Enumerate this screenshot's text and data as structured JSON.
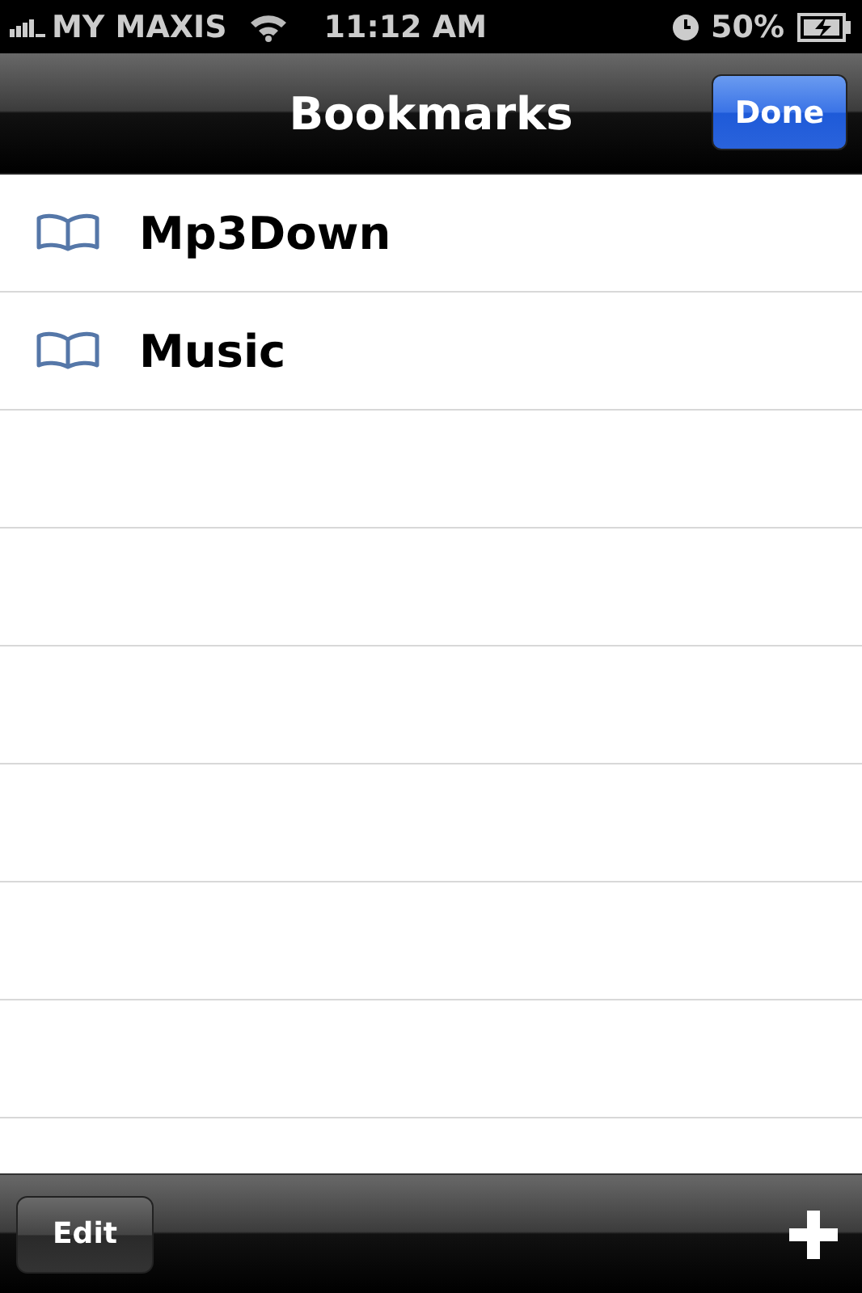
{
  "status_bar": {
    "carrier": "MY MAXIS",
    "time": "11:12 AM",
    "battery": "50%"
  },
  "nav_bar": {
    "title": "Bookmarks",
    "done_button": "Done"
  },
  "bookmarks": [
    {
      "title": "Mp3Down"
    },
    {
      "title": "Music"
    }
  ],
  "toolbar": {
    "edit_button": "Edit"
  }
}
